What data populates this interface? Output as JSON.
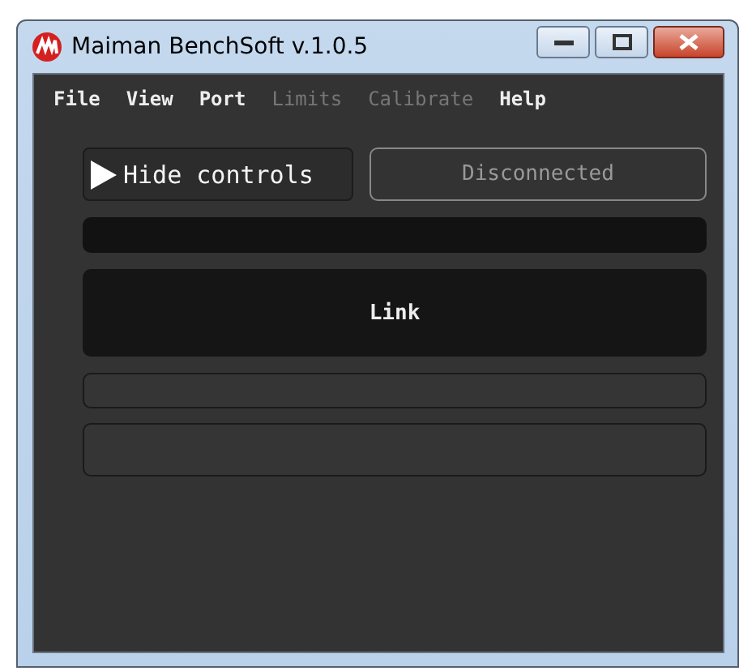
{
  "window": {
    "title": "Maiman BenchSoft v.1.0.5"
  },
  "menu": [
    {
      "label": "File",
      "disabled": false
    },
    {
      "label": "View",
      "disabled": false
    },
    {
      "label": "Port",
      "disabled": false
    },
    {
      "label": "Limits",
      "disabled": true
    },
    {
      "label": "Calibrate",
      "disabled": true
    },
    {
      "label": "Help",
      "disabled": false
    }
  ],
  "toggle_button": {
    "label": "Hide controls"
  },
  "status": {
    "label": "Disconnected"
  },
  "link_panel": {
    "label": "Link"
  }
}
